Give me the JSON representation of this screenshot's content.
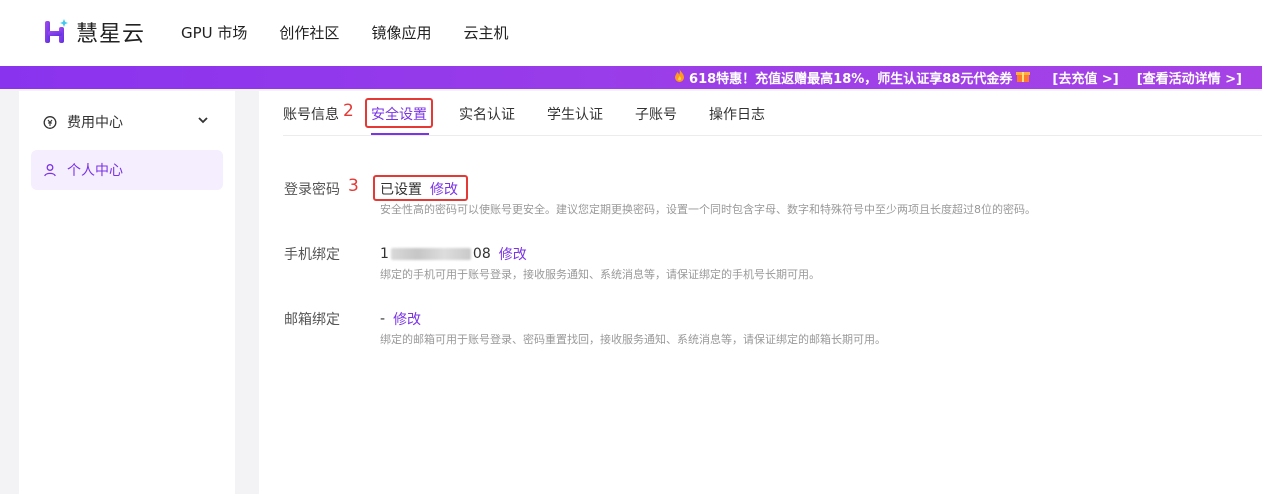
{
  "brand": {
    "name": "慧星云",
    "accent": "#7b34e6"
  },
  "nav": {
    "items": [
      "GPU 市场",
      "创作社区",
      "镜像应用",
      "云主机"
    ]
  },
  "promo": {
    "text": "618特惠！充值返赠最高18%，师生认证享88元代金券",
    "recharge_link": "[去充值 >]",
    "details_link": "[查看活动详情 >]"
  },
  "sidebar": {
    "items": [
      {
        "label": "费用中心",
        "icon": "coin-icon",
        "has_chevron": true
      },
      {
        "label": "个人中心",
        "icon": "user-icon",
        "active": true
      }
    ]
  },
  "tabs": {
    "items": [
      "账号信息",
      "安全设置",
      "实名认证",
      "学生认证",
      "子账号",
      "操作日志"
    ],
    "active": "安全设置"
  },
  "annotations": {
    "step2": "2",
    "step3": "3"
  },
  "security": {
    "password": {
      "label": "登录密码",
      "value": "已设置",
      "action": "修改",
      "desc": "安全性高的密码可以使账号更安全。建议您定期更换密码，设置一个同时包含字母、数字和特殊符号中至少两项且长度超过8位的密码。"
    },
    "phone": {
      "label": "手机绑定",
      "value_prefix": "1",
      "value_suffix": "08",
      "action": "修改",
      "desc": "绑定的手机可用于账号登录，接收服务通知、系统消息等，请保证绑定的手机号长期可用。"
    },
    "email": {
      "label": "邮箱绑定",
      "value": "-",
      "action": "修改",
      "desc": "绑定的邮箱可用于账号登录、密码重置找回，接收服务通知、系统消息等，请保证绑定的邮箱长期可用。"
    }
  }
}
